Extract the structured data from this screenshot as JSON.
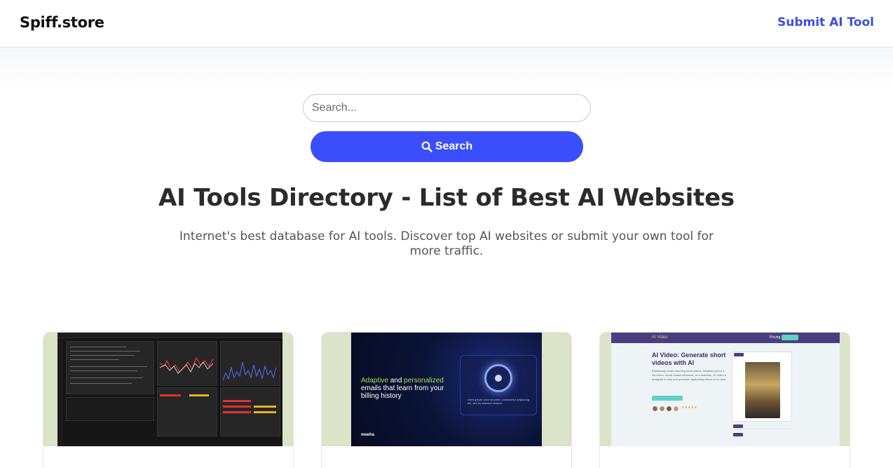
{
  "header": {
    "logo": "Spiff.store",
    "submit_link": "Submit AI Tool"
  },
  "search": {
    "placeholder": "Search...",
    "button_label": "Search",
    "button_icon": "search-icon"
  },
  "hero": {
    "title": "AI Tools Directory - List of Best AI Websites",
    "subtitle": "Internet's best database for AI tools. Discover top AI websites or submit your own tool for more traffic."
  },
  "colors": {
    "accent": "#3a4ffb",
    "link": "#3b4fe0",
    "card_thumb_bg": "#dbe3c9"
  },
  "cards": [
    {
      "thumbnail": "dark-trading-dashboard-screenshot"
    },
    {
      "thumbnail": "email-marketing-screenshot",
      "shot_text_part1": "Adaptive",
      "shot_text_and": " and ",
      "shot_text_part2": "personalized",
      "shot_text_rest": " emails that learn from your billing history",
      "shot_caption": "Used ipsum dolor sit amet, consectetur adipiscing elit, sed do eiusmod tempor.",
      "shot_brand": "meeha"
    },
    {
      "thumbnail": "ai-video-screenshot",
      "shot_nav_title": "AI Video",
      "shot_nav_pricing": "Pricing",
      "shot_heading": "AI Video: Generate short videos with AI",
      "shot_body": "Effortlessly create stunning short videos. Whether you're a YouTuber, social media influencer, or a marketer, AI Video is designed to help you generate captivating videos in no time.",
      "shot_stars": "★★★★★"
    }
  ]
}
